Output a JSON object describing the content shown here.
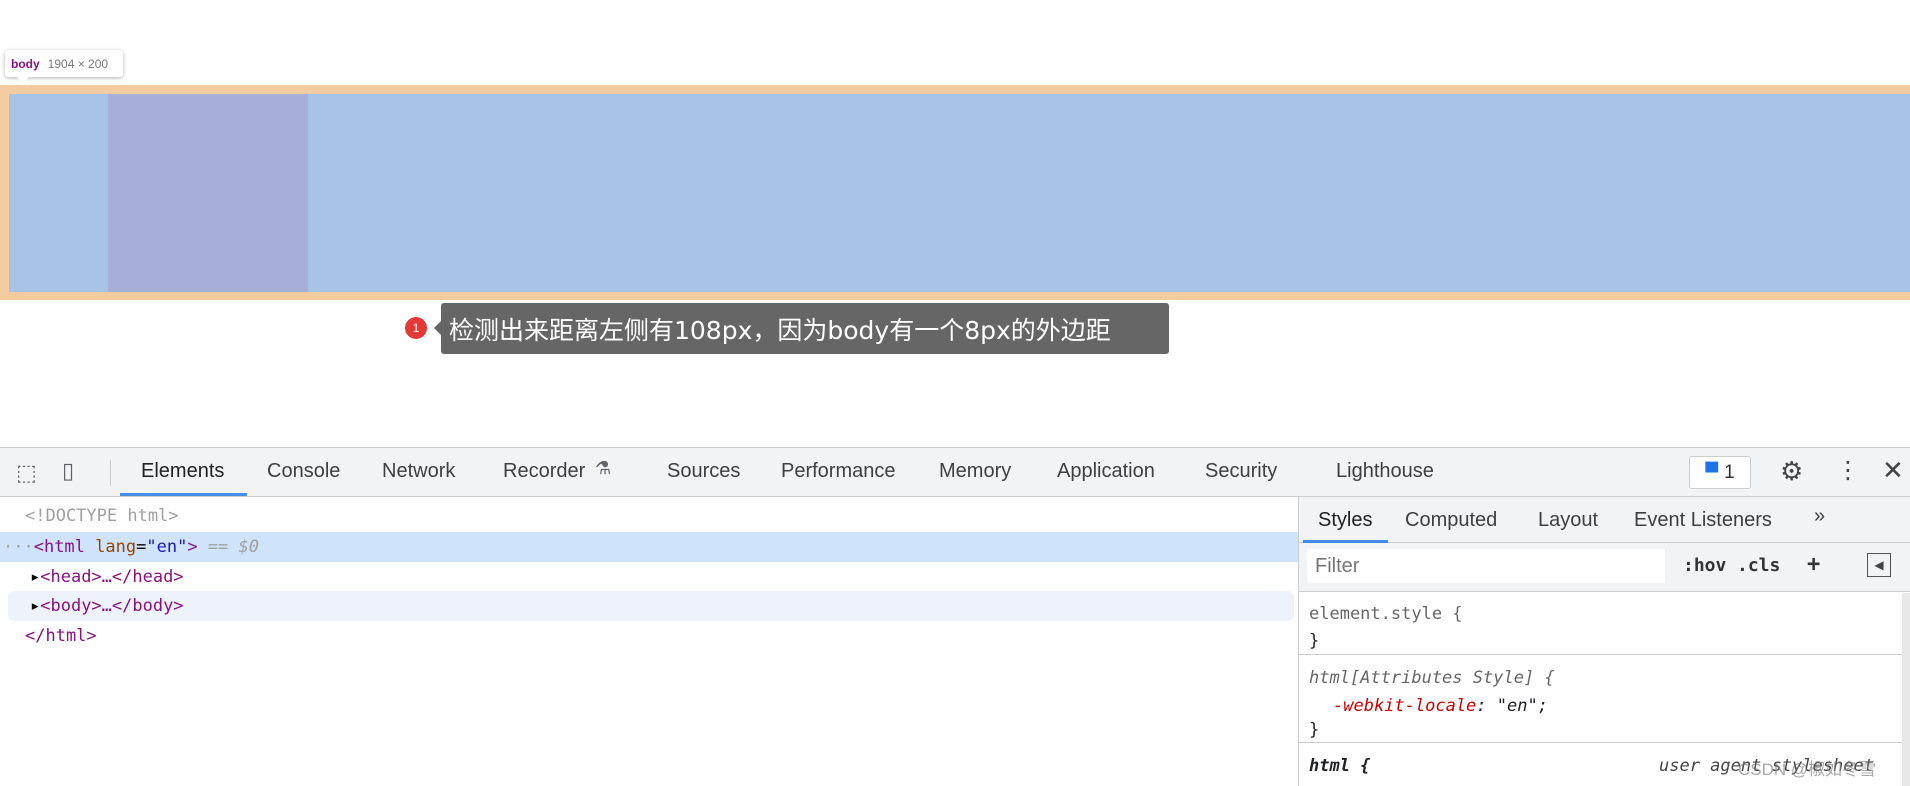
{
  "overlay": {
    "tag": "body",
    "size": "1904 × 200"
  },
  "annotation": {
    "badge": "1",
    "text": "检测出来距离左侧有108px，因为body有一个8px的外边距"
  },
  "devtools": {
    "tabs": [
      "Elements",
      "Console",
      "Network",
      "Recorder",
      "Sources",
      "Performance",
      "Memory",
      "Application",
      "Security",
      "Lighthouse"
    ],
    "active_tab": "Elements",
    "issues_count": "1",
    "dom": {
      "doctype": "<!DOCTYPE html>",
      "html_open": "<html",
      "html_attr": "lang",
      "html_val": "\"en\"",
      "html_close": ">",
      "selected_marker": "== $0",
      "head": "<head>…</head>",
      "body": "<body>…</body>",
      "html_end": "</html>"
    },
    "styles": {
      "tabs": [
        "Styles",
        "Computed",
        "Layout",
        "Event Listeners"
      ],
      "filter_placeholder": "Filter",
      "hov": ":hov",
      "cls": ".cls",
      "add": "+",
      "rules": {
        "element_style": "element.style {",
        "close": "}",
        "attr_selector": "html[Attributes Style] {",
        "prop": "-webkit-locale",
        "value": ": \"en\";",
        "html_selector": "html {",
        "ua": "user agent stylesheet"
      }
    }
  },
  "watermark": "CSDN @椒如冬雪",
  "colors": {
    "margin": "#f3cba0",
    "content": "#a7c4e8",
    "accent": "#1a73e8"
  }
}
